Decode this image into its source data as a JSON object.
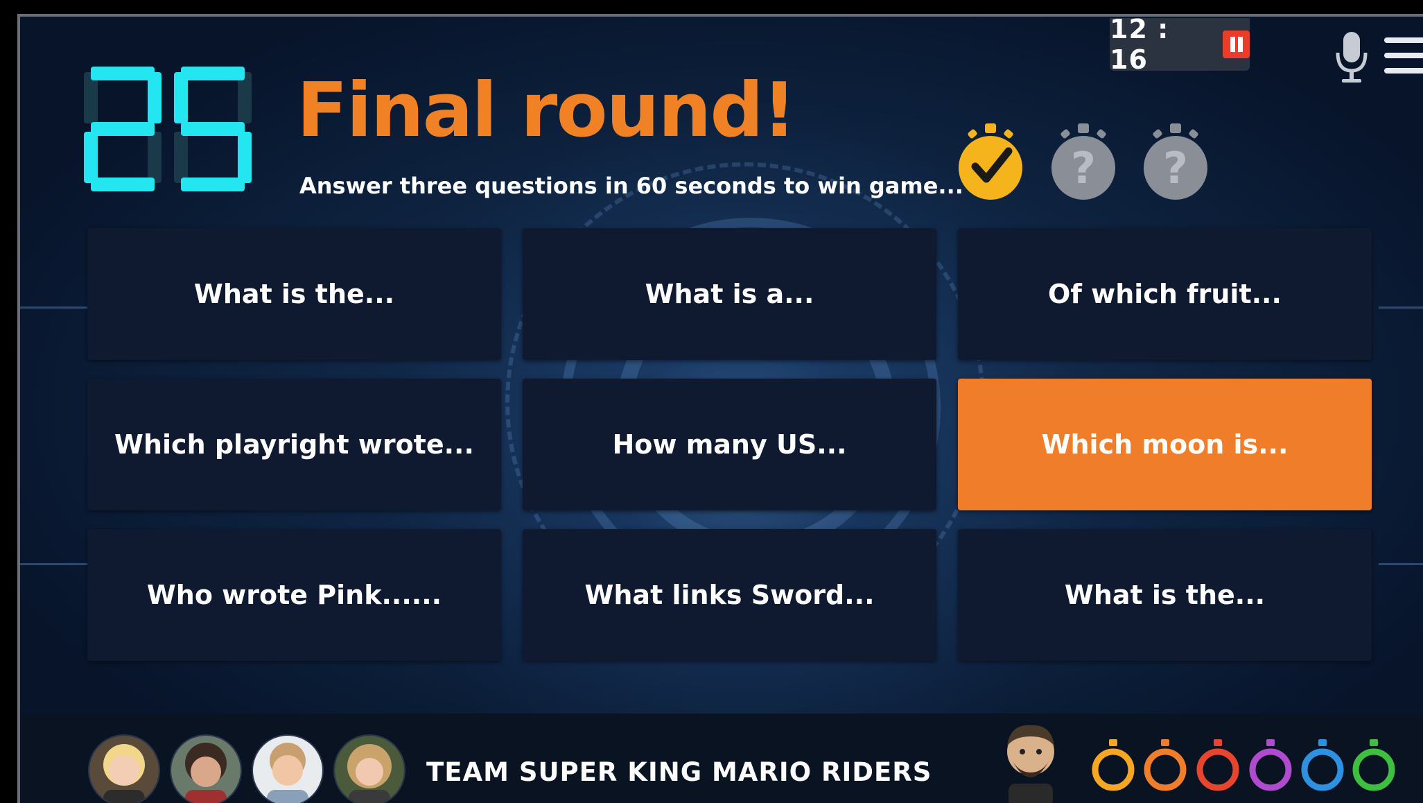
{
  "clock": {
    "time": "12 : 16",
    "pause_icon": "pause-icon"
  },
  "toolbar": {
    "mic_icon": "microphone-icon",
    "menu_icon": "hamburger-menu-icon"
  },
  "countdown": {
    "value": "25",
    "color": "#24e6f0"
  },
  "header": {
    "title": "Final round!",
    "subtitle": "Answer three questions in 60 seconds to win game...",
    "title_color": "#f08125"
  },
  "progress": {
    "answered": 1,
    "total": 3,
    "items": [
      {
        "state": "correct",
        "icon": "stopwatch-check-icon",
        "color": "#f5b31c"
      },
      {
        "state": "pending",
        "icon": "stopwatch-question-icon",
        "color": "#8a8f97"
      },
      {
        "state": "pending",
        "icon": "stopwatch-question-icon",
        "color": "#8a8f97"
      }
    ]
  },
  "questions": [
    {
      "label": "What is the...",
      "active": false
    },
    {
      "label": "What is a...",
      "active": false
    },
    {
      "label": "Of which fruit...",
      "active": false
    },
    {
      "label": "Which playright wrote...",
      "active": false
    },
    {
      "label": "How many US...",
      "active": false
    },
    {
      "label": "Which moon is...",
      "active": true
    },
    {
      "label": "Who wrote Pink......",
      "active": false
    },
    {
      "label": "What links Sword...",
      "active": false
    },
    {
      "label": "What is the...",
      "active": false
    }
  ],
  "accent_color": "#f07d2a",
  "team": {
    "name": "TEAM SUPER KING MARIO RIDERS",
    "members": [
      "avatar-1",
      "avatar-2",
      "avatar-3",
      "avatar-4"
    ],
    "host_icon": "host-avatar-icon"
  },
  "lives": {
    "icon": "stopwatch-icon",
    "colors": [
      "#f5a623",
      "#f07d2a",
      "#e8452f",
      "#b04bd0",
      "#2e90e0",
      "#3fbf3f"
    ]
  }
}
